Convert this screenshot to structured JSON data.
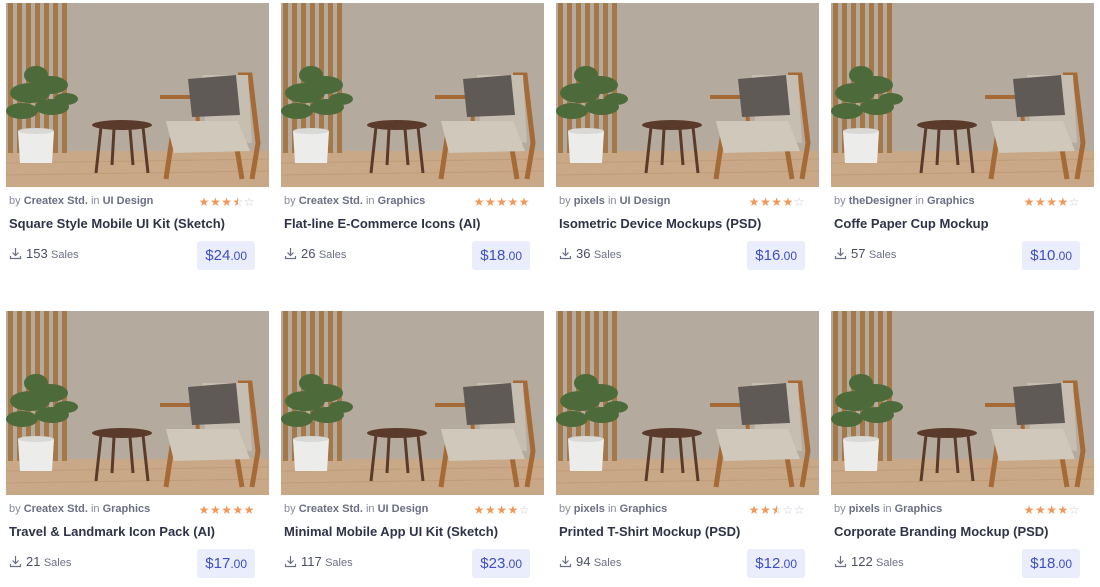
{
  "products": [
    {
      "author": "Createx Std.",
      "category": "UI Design",
      "title": "Square Style Mobile UI Kit (Sketch)",
      "rating": 3.5,
      "sales": "153",
      "price_dollars": "$24",
      "price_cents": ".00"
    },
    {
      "author": "Createx Std.",
      "category": "Graphics",
      "title": "Flat-line E-Commerce Icons (AI)",
      "rating": 5,
      "sales": "26",
      "price_dollars": "$18",
      "price_cents": ".00"
    },
    {
      "author": "pixels",
      "category": "UI Design",
      "title": "Isometric Device Mockups (PSD)",
      "rating": 4,
      "sales": "36",
      "price_dollars": "$16",
      "price_cents": ".00"
    },
    {
      "author": "theDesigner",
      "category": "Graphics",
      "title": "Coffe Paper Cup Mockup",
      "rating": 4,
      "sales": "57",
      "price_dollars": "$10",
      "price_cents": ".00"
    },
    {
      "author": "Createx Std.",
      "category": "Graphics",
      "title": "Travel & Landmark Icon Pack (AI)",
      "rating": 5,
      "sales": "21",
      "price_dollars": "$17",
      "price_cents": ".00"
    },
    {
      "author": "Createx Std.",
      "category": "UI Design",
      "title": "Minimal Mobile App UI Kit (Sketch)",
      "rating": 4,
      "sales": "117",
      "price_dollars": "$23",
      "price_cents": ".00"
    },
    {
      "author": "pixels",
      "category": "Graphics",
      "title": "Printed T-Shirt Mockup (PSD)",
      "rating": 2.5,
      "sales": "94",
      "price_dollars": "$12",
      "price_cents": ".00"
    },
    {
      "author": "pixels",
      "category": "Graphics",
      "title": "Corporate Branding Mockup (PSD)",
      "rating": 4,
      "sales": "122",
      "price_dollars": "$18",
      "price_cents": ".00"
    }
  ],
  "labels": {
    "by": "by",
    "in": "in",
    "sales": "Sales"
  },
  "colors": {
    "star": "#f0975a",
    "price_bg": "#eaedfb",
    "price_text": "#3e4ec4"
  },
  "icons": {
    "sales": "download-icon",
    "thumbnail": "armchair-room-image"
  }
}
